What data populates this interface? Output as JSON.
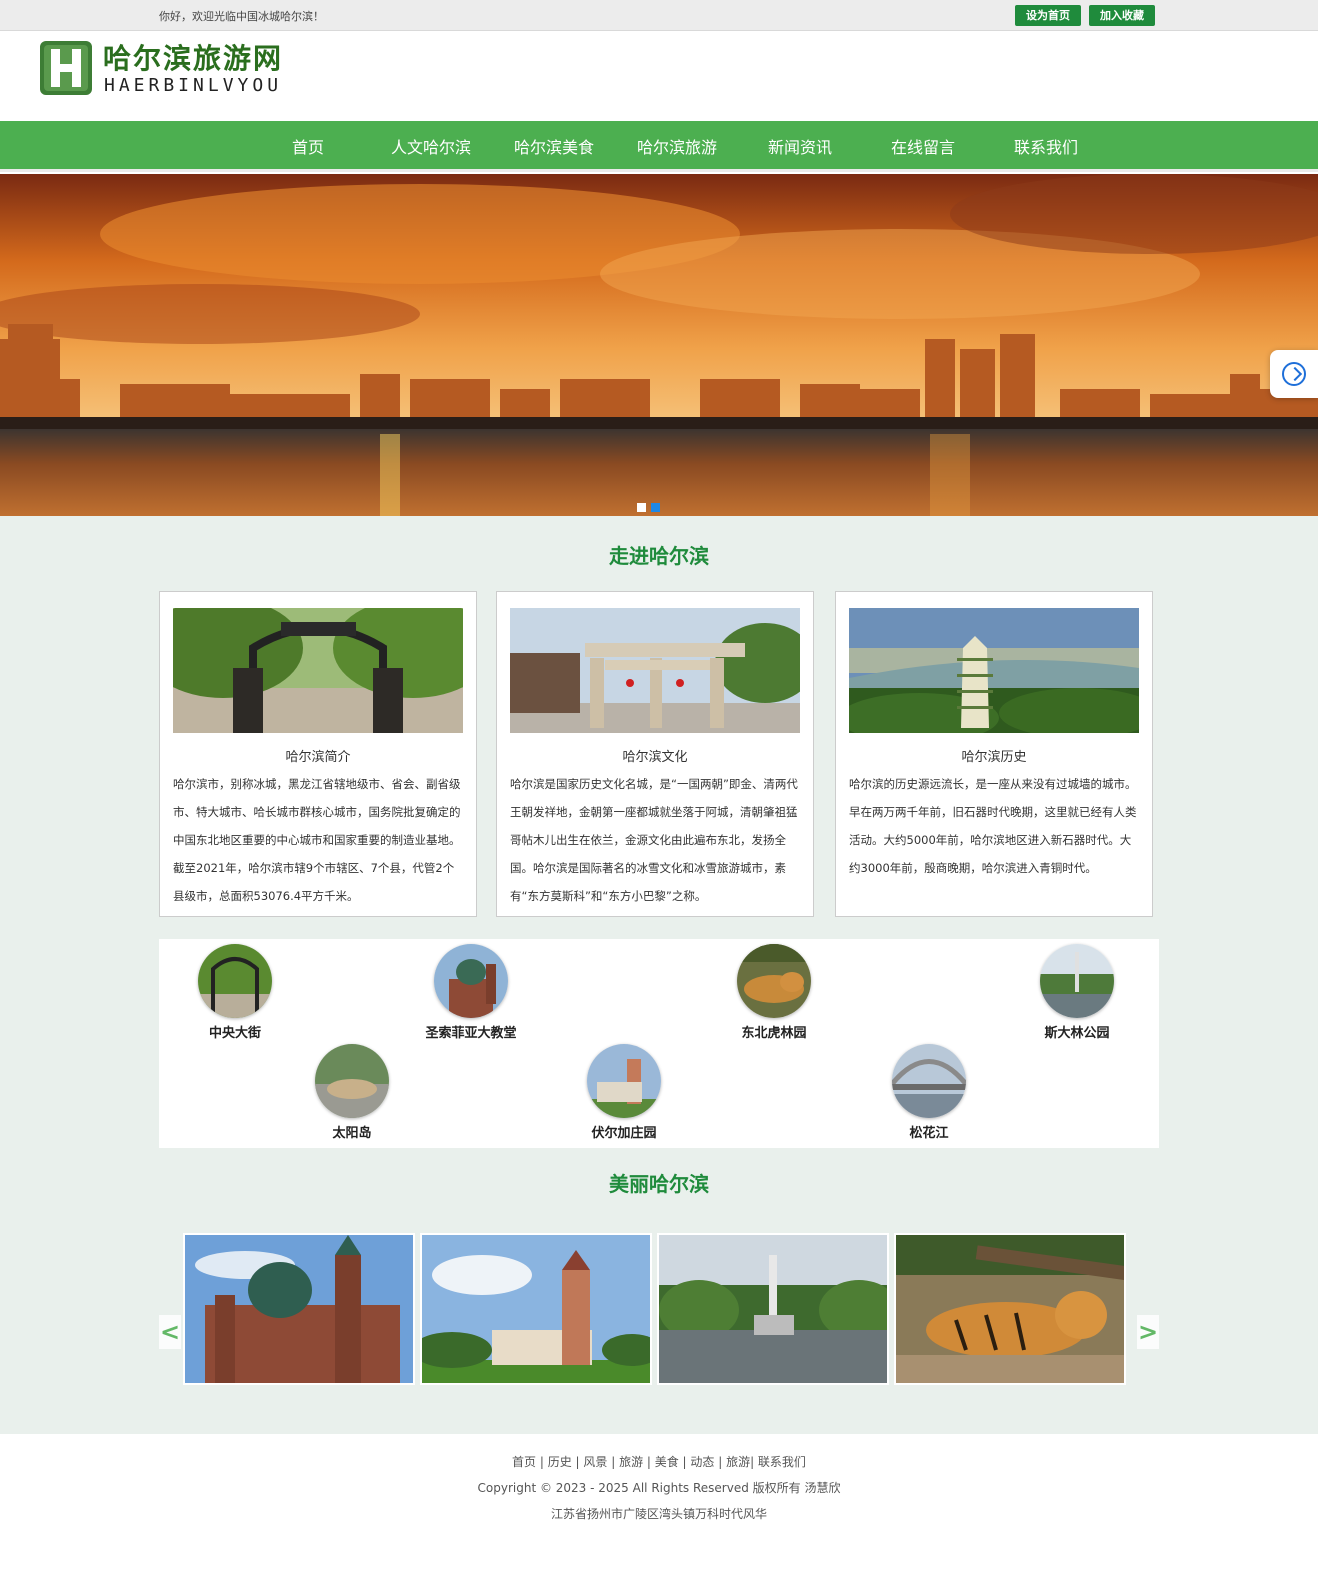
{
  "topbar": {
    "welcome": "你好，欢迎光临中国冰城哈尔滨！",
    "set_home": "设为首页",
    "add_favorite": "加入收藏"
  },
  "logo": {
    "name_cn": "哈尔滨旅游网",
    "name_en": "HAERBINLVYOU",
    "mark": "H"
  },
  "nav": [
    "首页",
    "人文哈尔滨",
    "哈尔滨美食",
    "哈尔滨旅游",
    "新闻资讯",
    "在线留言",
    "联系我们"
  ],
  "banner": {
    "slides": 2,
    "active_dot": 2
  },
  "intro": {
    "title": "走进哈尔滨",
    "cards": [
      {
        "title": "哈尔滨简介",
        "text": "哈尔滨市，别称冰城，黑龙江省辖地级市、省会、副省级市、特大城市、哈长城市群核心城市，国务院批复确定的中国东北地区重要的中心城市和国家重要的制造业基地。 截至2021年，哈尔滨市辖9个市辖区、7个县，代管2个县级市，总面积53076.4平方千米。"
      },
      {
        "title": "哈尔滨文化",
        "text": "哈尔滨是国家历史文化名城，是“一国两朝”即金、清两代王朝发祥地，金朝第一座都城就坐落于阿城，清朝肇祖猛哥帖木儿出生在依兰，金源文化由此遍布东北，发扬全国。哈尔滨是国际著名的冰雪文化和冰雪旅游城市，素有“东方莫斯科”和“东方小巴黎”之称。"
      },
      {
        "title": "哈尔滨历史",
        "text": "哈尔滨的历史源远流长，是一座从来没有过城墙的城市。早在两万两千年前，旧石器时代晚期，这里就已经有人类活动。大约5000年前，哈尔滨地区进入新石器时代。大约3000年前，殷商晚期，哈尔滨进入青铜时代。"
      }
    ]
  },
  "spots": [
    "中央大街",
    "圣索菲亚大教堂",
    "东北虎林园",
    "斯大林公园",
    "太阳岛",
    "伏尔加庄园",
    "松花江"
  ],
  "gallery": {
    "title": "美丽哈尔滨",
    "prev": "<",
    "next": ">"
  },
  "footer": {
    "links": "首页 | 历史 | 风景 | 旅游 | 美食 | 动态 | 旅游| 联系我们",
    "copyright": "Copyright © 2023 - 2025 All Rights Reserved 版权所有 汤慧欣",
    "address": "江苏省扬州市广陵区湾头镇万科时代风华"
  },
  "colors": {
    "brand_green": "#4caf50",
    "button_green": "#1f8b3c",
    "title_green": "#1f8b3c",
    "section_bg": "#e9f0ec"
  }
}
